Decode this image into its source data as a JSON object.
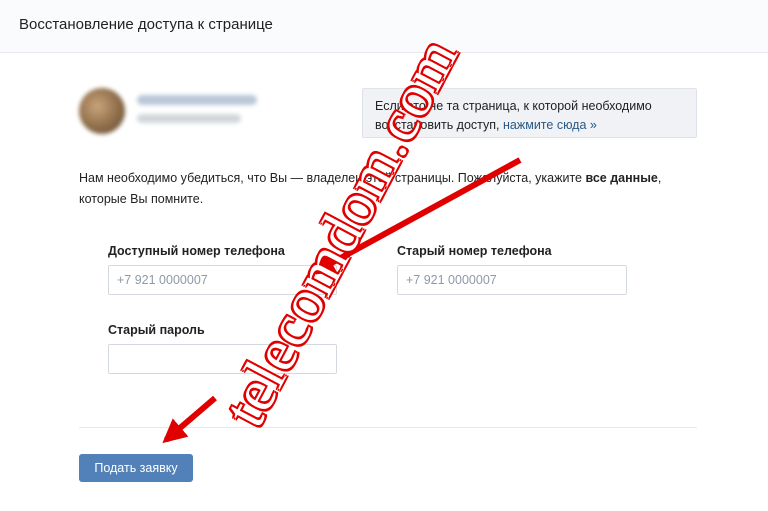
{
  "header": {
    "title": "Восстановление доступа к странице"
  },
  "notice": {
    "text": "Если это не та страница, к которой необходимо восстановить доступ,",
    "link": "нажмите сюда »"
  },
  "intro": {
    "before": "Нам необходимо убедиться, что Вы — владелец этой страницы. Пожалуйста, укажите ",
    "bold": "все данные",
    "after": ", которые Вы помните."
  },
  "form": {
    "available_phone_label": "Доступный номер телефона",
    "available_phone_placeholder": "+7 921 0000007",
    "old_phone_label": "Старый номер телефона",
    "old_phone_placeholder": "+7 921 0000007",
    "old_password_label": "Старый пароль",
    "old_password_value": ""
  },
  "submit_label": "Подать заявку",
  "watermark": "telecomdom.com",
  "colors": {
    "accent": "#5181b8",
    "link": "#2a5885",
    "annotation": "#e00000"
  }
}
